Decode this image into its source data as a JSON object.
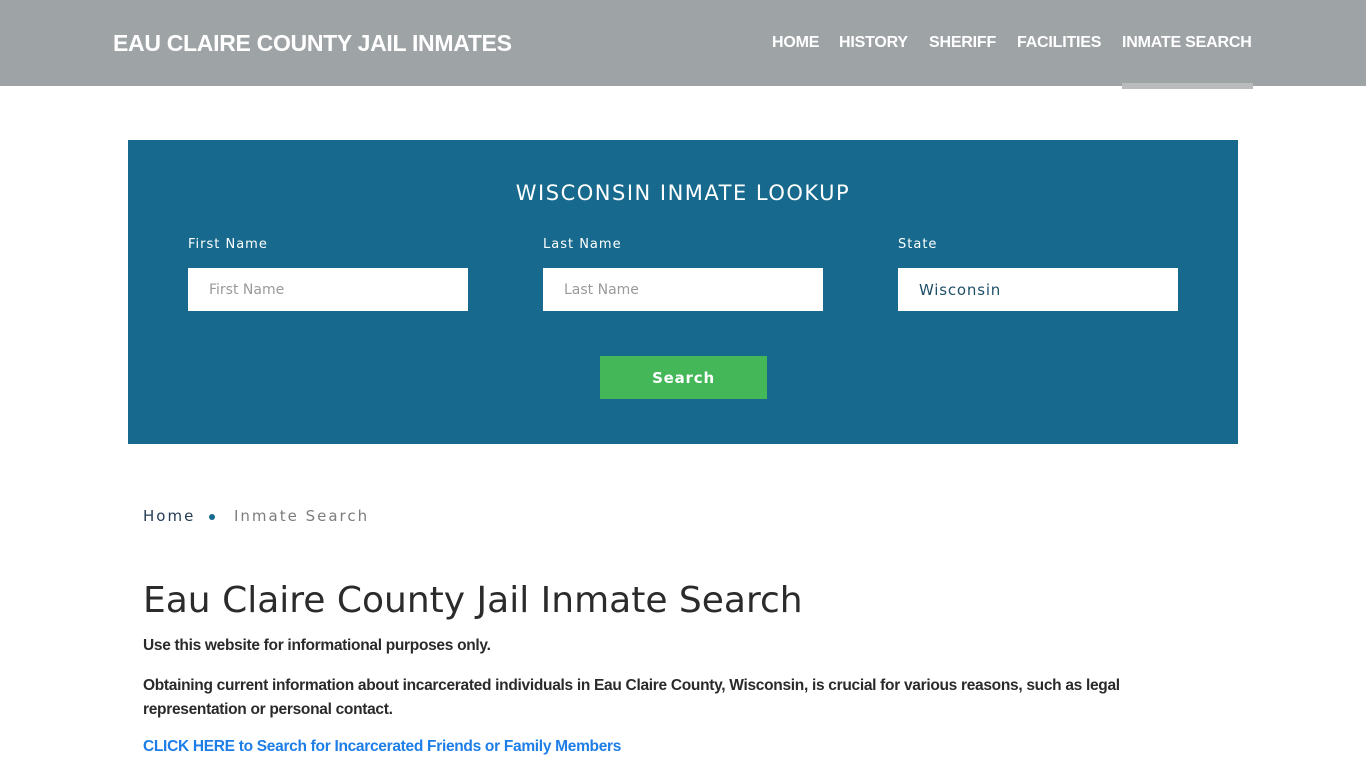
{
  "header": {
    "site_title": "EAU CLAIRE COUNTY JAIL INMATES",
    "nav": [
      {
        "label": "HOME",
        "active": false
      },
      {
        "label": "HISTORY",
        "active": false
      },
      {
        "label": "SHERIFF",
        "active": false
      },
      {
        "label": "FACILITIES",
        "active": false
      },
      {
        "label": "INMATE SEARCH",
        "active": true
      }
    ]
  },
  "lookup": {
    "title": "WISCONSIN INMATE LOOKUP",
    "fields": [
      {
        "label": "First Name",
        "placeholder": "First Name",
        "value": ""
      },
      {
        "label": "Last Name",
        "placeholder": "Last Name",
        "value": ""
      },
      {
        "label": "State",
        "placeholder": "",
        "value": "Wisconsin"
      }
    ],
    "search_label": "Search"
  },
  "breadcrumb": {
    "home": "Home",
    "current": "Inmate Search"
  },
  "content": {
    "title": "Eau Claire County Jail Inmate Search",
    "paragraph_1": "Use this website for informational purposes only.",
    "paragraph_2": "Obtaining current information about incarcerated individuals in Eau Claire County, Wisconsin, is crucial for various reasons, such as legal representation or personal contact.",
    "cta_link": "CLICK HERE to Search for Incarcerated Friends or Family Members"
  },
  "colors": {
    "header_bg": "#9ea3a6",
    "lookup_bg": "#176a8d",
    "search_button": "#44b758",
    "link": "#1d7ee8"
  }
}
